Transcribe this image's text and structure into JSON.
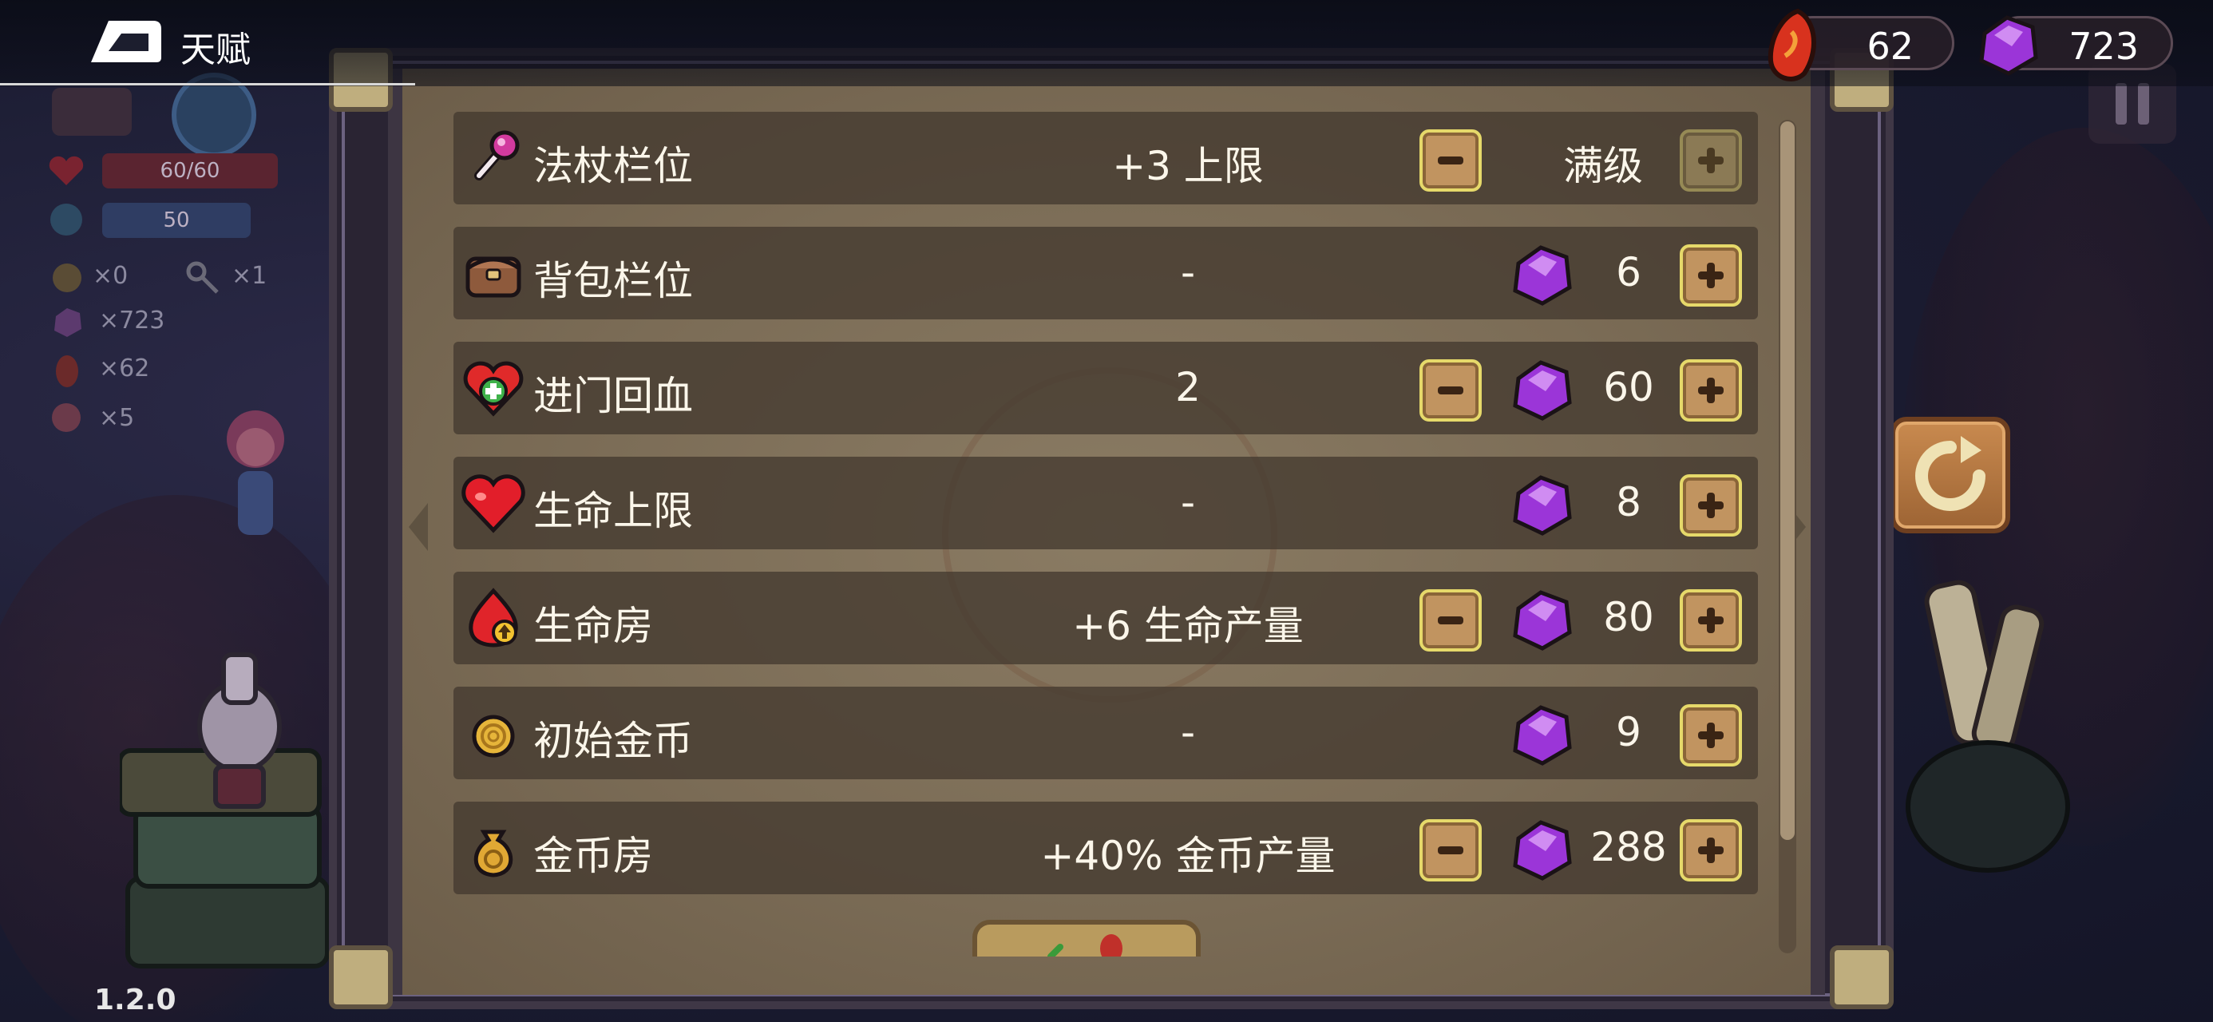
{
  "header": {
    "title": "天赋",
    "currencies": [
      {
        "icon": "red-crystal-icon",
        "value": "62"
      },
      {
        "icon": "purple-gem-icon",
        "value": "723"
      }
    ]
  },
  "hud": {
    "hp": "60/60",
    "mana": "50",
    "items": [
      {
        "icon": "coin-icon",
        "count": "×0"
      },
      {
        "icon": "key-icon",
        "count": "×1"
      },
      {
        "icon": "purple-gem-icon",
        "count": "×723"
      },
      {
        "icon": "red-crystal-icon",
        "count": "×62"
      },
      {
        "icon": "flower-icon",
        "count": "×5"
      }
    ]
  },
  "version": "1.2.0",
  "talents": [
    {
      "icon": "wand-icon",
      "name": "法杖栏位",
      "effect": "+3 上限",
      "cost": "",
      "status": "满级",
      "has_minus": true,
      "plus_disabled": true
    },
    {
      "icon": "backpack-icon",
      "name": "背包栏位",
      "effect": "-",
      "cost": "6",
      "status": "",
      "has_minus": false,
      "plus_disabled": false
    },
    {
      "icon": "heart-plus-icon",
      "name": "进门回血",
      "effect": "2",
      "cost": "60",
      "status": "",
      "has_minus": true,
      "plus_disabled": false
    },
    {
      "icon": "heart-icon",
      "name": "生命上限",
      "effect": "-",
      "cost": "8",
      "status": "",
      "has_minus": false,
      "plus_disabled": false
    },
    {
      "icon": "life-room-icon",
      "name": "生命房",
      "effect": "+6 生命产量",
      "cost": "80",
      "status": "",
      "has_minus": true,
      "plus_disabled": false
    },
    {
      "icon": "coin-icon",
      "name": "初始金币",
      "effect": "-",
      "cost": "9",
      "status": "",
      "has_minus": false,
      "plus_disabled": false
    },
    {
      "icon": "money-bag-icon",
      "name": "金币房",
      "effect": "+40% 金币产量",
      "cost": "288",
      "status": "",
      "has_minus": true,
      "plus_disabled": false
    }
  ],
  "colors": {
    "parchment": "#7b6c56",
    "row_bg": "#443a30",
    "button_gold": "#c19460",
    "button_border": "#e6d96a",
    "gem_purple": "#9b35d8"
  }
}
